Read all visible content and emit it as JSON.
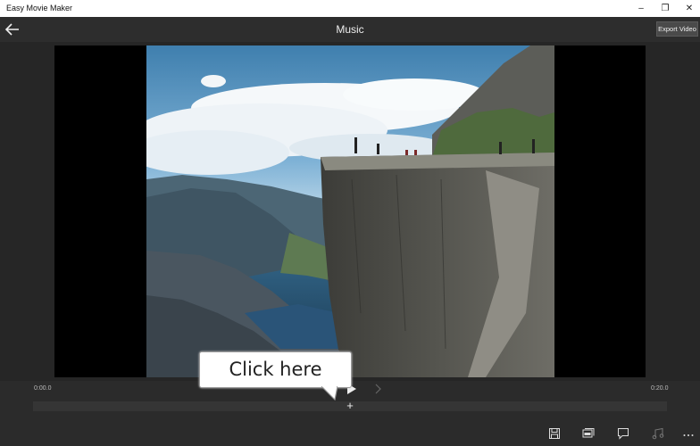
{
  "app": {
    "title": "Easy Movie Maker"
  },
  "window_controls": {
    "minimize": "–",
    "restore": "❐",
    "close": "✕"
  },
  "header": {
    "title": "Music",
    "export_label": "Export Video"
  },
  "timeline": {
    "start_time": "0:00.0",
    "end_time": "0:20.0",
    "add_label": "+"
  },
  "callout": {
    "text": "Click here"
  },
  "bottom_toolbar": {
    "icons": [
      "save-icon",
      "slideshow-icon",
      "comment-icon",
      "music-icon",
      "more-icon"
    ]
  }
}
